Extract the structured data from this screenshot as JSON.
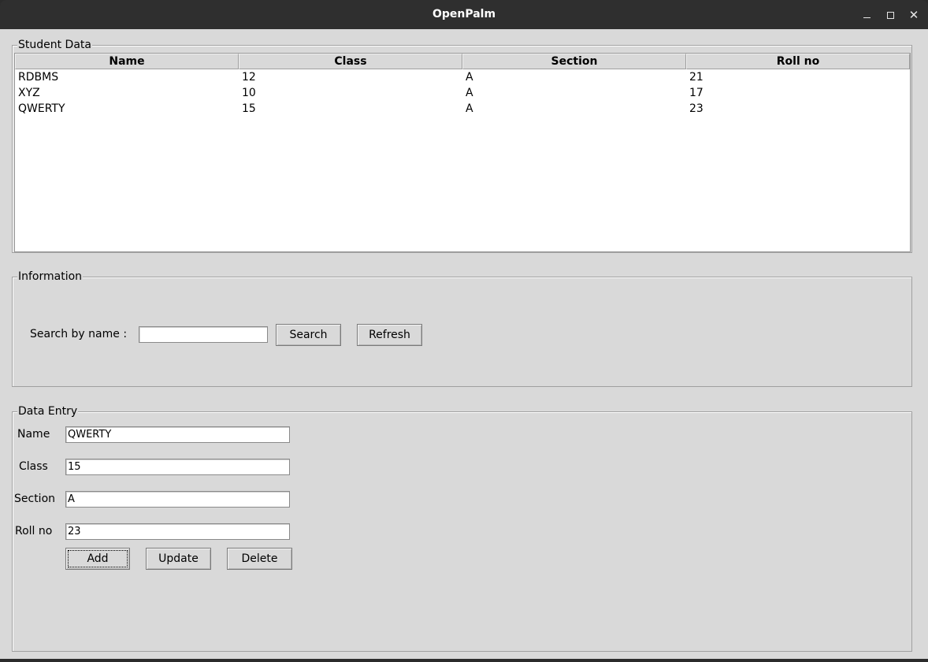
{
  "window": {
    "title": "OpenPalm",
    "minimize_glyph": "",
    "maximize_glyph": "",
    "close_glyph": "✕"
  },
  "student_data": {
    "legend": "Student Data",
    "columns": [
      "Name",
      "Class",
      "Section",
      "Roll no"
    ],
    "rows": [
      [
        "RDBMS",
        "12",
        "A",
        "21"
      ],
      [
        "XYZ",
        "10",
        "A",
        "17"
      ],
      [
        "QWERTY",
        "15",
        "A",
        "23"
      ]
    ]
  },
  "information": {
    "legend": "Information",
    "search_label": "Search by name :",
    "search_value": "",
    "search_button": "Search",
    "refresh_button": "Refresh"
  },
  "data_entry": {
    "legend": "Data Entry",
    "name_label": "Name",
    "name_value": "QWERTY",
    "class_label": "Class",
    "class_value": "15",
    "section_label": "Section",
    "section_value": "A",
    "roll_label": "Roll no",
    "roll_value": "23",
    "add_button": "Add",
    "update_button": "Update",
    "delete_button": "Delete"
  },
  "icons": {
    "minimize": "minimize-icon",
    "maximize": "maximize-icon",
    "close": "close-icon"
  }
}
